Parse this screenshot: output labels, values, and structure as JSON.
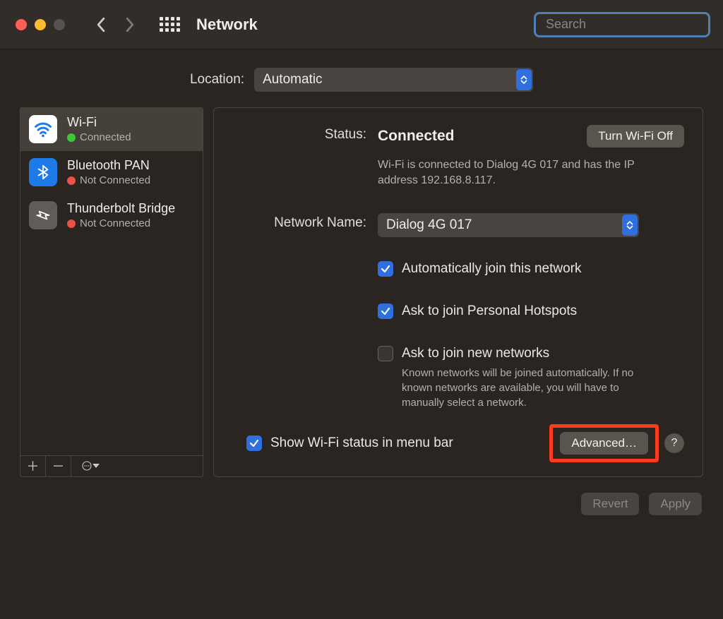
{
  "window": {
    "title": "Network"
  },
  "search": {
    "placeholder": "Search"
  },
  "location": {
    "label": "Location:",
    "value": "Automatic"
  },
  "sidebar": {
    "items": [
      {
        "name": "Wi-Fi",
        "status": "Connected",
        "dot": "green",
        "selected": true
      },
      {
        "name": "Bluetooth PAN",
        "status": "Not Connected",
        "dot": "red",
        "selected": false
      },
      {
        "name": "Thunderbolt Bridge",
        "status": "Not Connected",
        "dot": "red",
        "selected": false
      }
    ]
  },
  "detail": {
    "status_label": "Status:",
    "status_value": "Connected",
    "toggle_button": "Turn Wi-Fi Off",
    "status_desc": "Wi-Fi is connected to Dialog 4G 017 and has the IP address 192.168.8.117.",
    "network_name_label": "Network Name:",
    "network_name_value": "Dialog 4G 017",
    "checkboxes": {
      "auto_join": {
        "label": "Automatically join this network",
        "checked": true
      },
      "ask_hotspots": {
        "label": "Ask to join Personal Hotspots",
        "checked": true
      },
      "ask_new": {
        "label": "Ask to join new networks",
        "checked": false,
        "help": "Known networks will be joined automatically. If no known networks are available, you will have to manually select a network."
      }
    },
    "show_menu_bar": {
      "label": "Show Wi-Fi status in menu bar",
      "checked": true
    },
    "advanced_button": "Advanced…"
  },
  "footer": {
    "revert": "Revert",
    "apply": "Apply"
  }
}
